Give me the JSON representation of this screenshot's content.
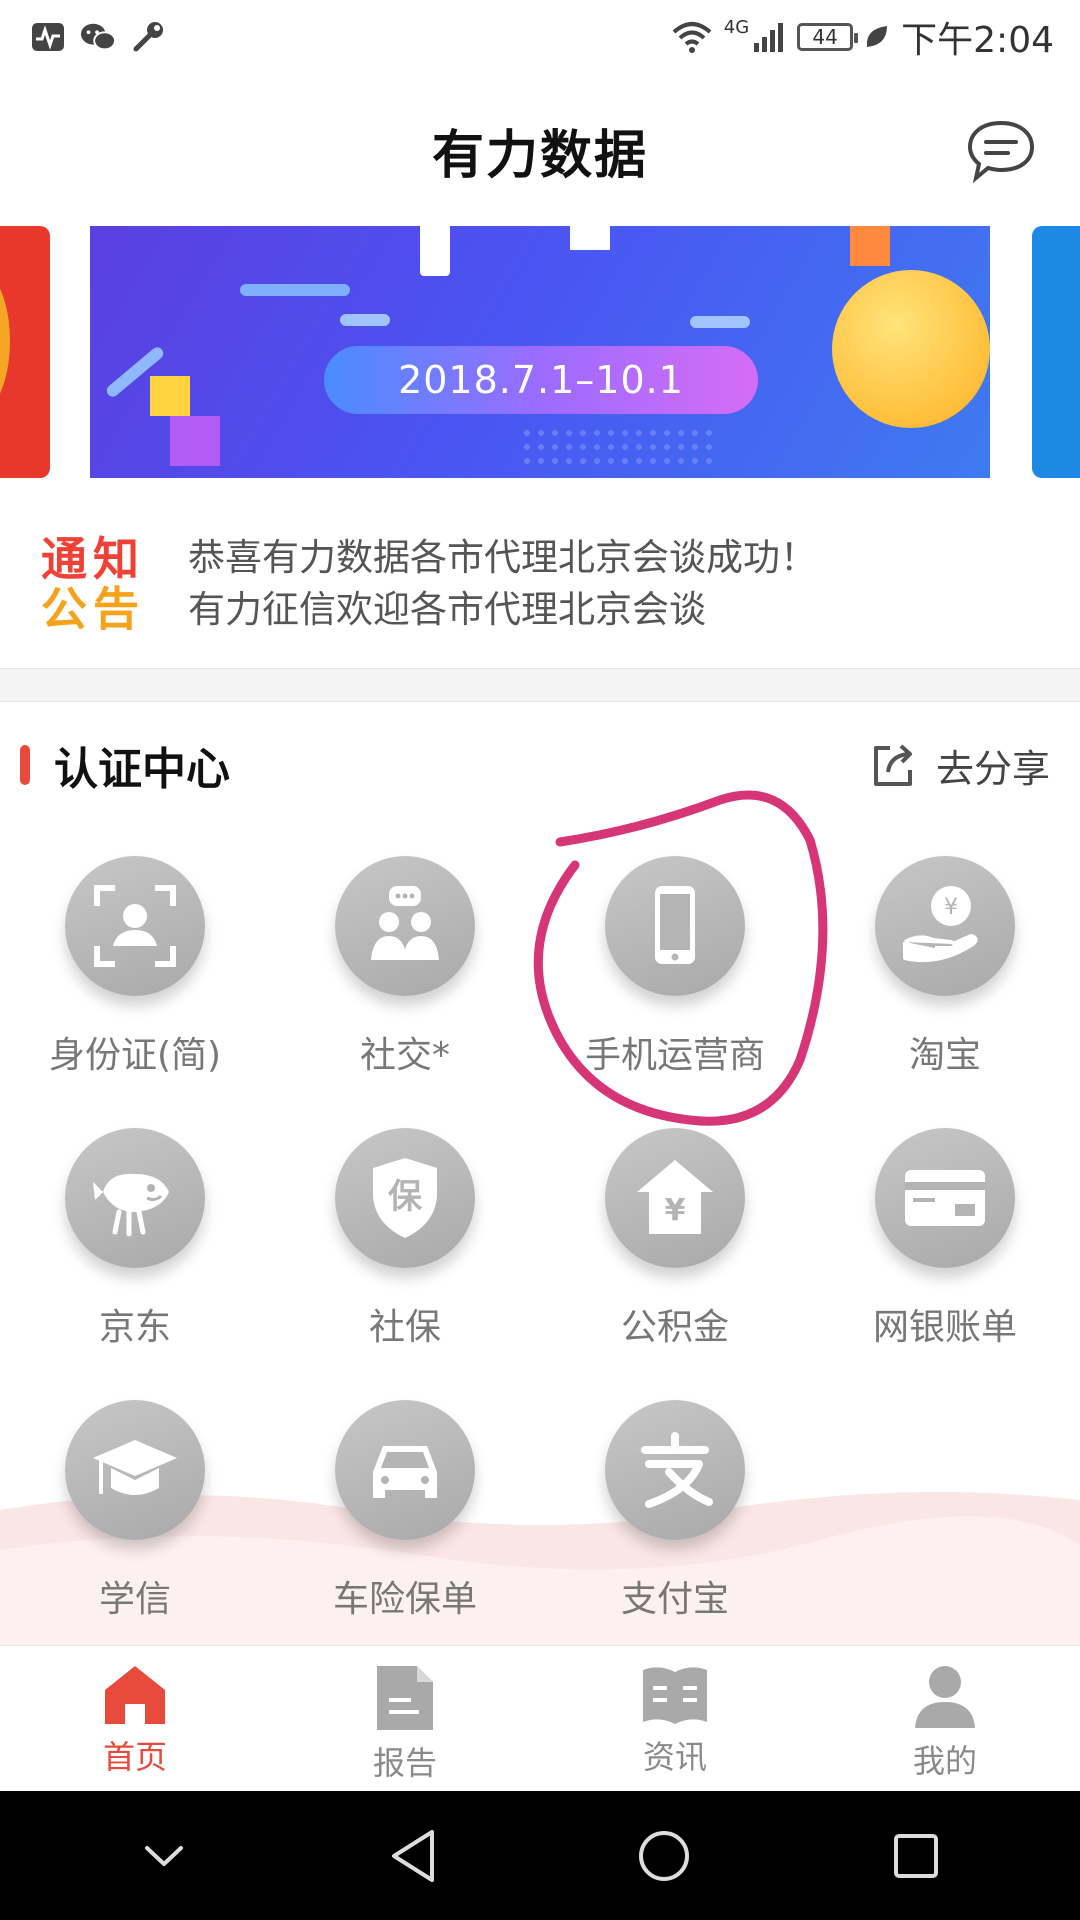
{
  "status_bar": {
    "network": "4G",
    "battery": "44",
    "time": "下午2:04"
  },
  "header": {
    "title": "有力数据"
  },
  "banner": {
    "date_range": "2018.7.1–10.1"
  },
  "notice": {
    "logo": [
      "通",
      "知",
      "公",
      "告"
    ],
    "lines": [
      "恭喜有力数据各市代理北京会谈成功！",
      "有力征信欢迎各市代理北京会谈"
    ]
  },
  "section": {
    "title": "认证中心",
    "share_label": "去分享"
  },
  "auth_items": [
    {
      "label": "身份证(简)",
      "icon": "id-card-icon"
    },
    {
      "label": "社交*",
      "icon": "social-icon"
    },
    {
      "label": "手机运营商",
      "icon": "phone-icon"
    },
    {
      "label": "淘宝",
      "icon": "taobao-icon"
    },
    {
      "label": "京东",
      "icon": "jd-icon"
    },
    {
      "label": "社保",
      "icon": "social-security-icon"
    },
    {
      "label": "公积金",
      "icon": "housing-fund-icon"
    },
    {
      "label": "网银账单",
      "icon": "bank-card-icon"
    },
    {
      "label": "学信",
      "icon": "graduation-cap-icon"
    },
    {
      "label": "车险保单",
      "icon": "car-icon"
    },
    {
      "label": "支付宝",
      "icon": "alipay-icon"
    }
  ],
  "bottom_nav": [
    {
      "label": "首页",
      "icon": "home-icon",
      "active": true
    },
    {
      "label": "报告",
      "icon": "report-icon",
      "active": false
    },
    {
      "label": "资讯",
      "icon": "news-icon",
      "active": false
    },
    {
      "label": "我的",
      "icon": "user-icon",
      "active": false
    }
  ],
  "colors": {
    "accent": "#e84a3b",
    "icon_gray": "#b4b4b4",
    "annotation": "#d63577"
  }
}
